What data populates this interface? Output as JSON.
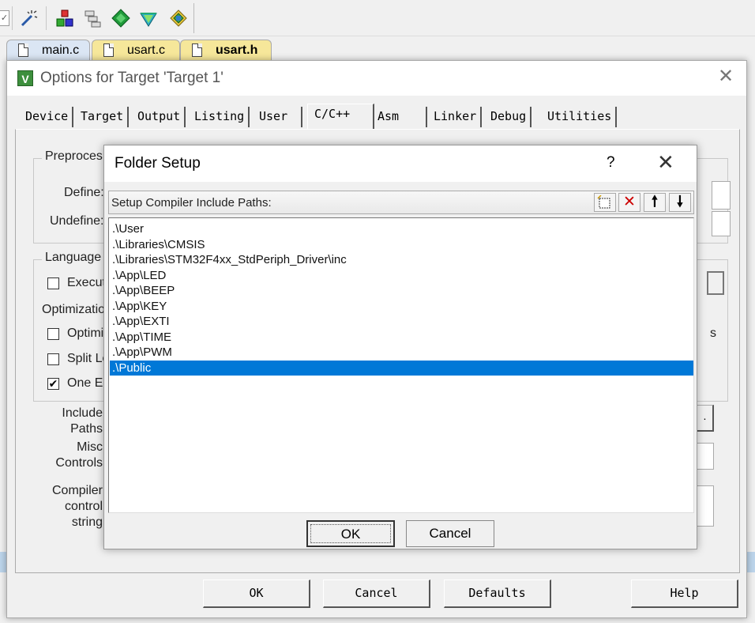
{
  "toolbar": {
    "icons": [
      "check-icon",
      "magic-wand-icon",
      "target-options-icon",
      "manage-components-icon",
      "pack-installer-icon",
      "select-software-icon",
      "run-time-environment-icon"
    ]
  },
  "file_tabs": [
    {
      "name": "main.c",
      "color": "#dbe6f4"
    },
    {
      "name": "usart.c",
      "color": "#f6e79a"
    },
    {
      "name": "usart.h",
      "color": "#f6e79a"
    }
  ],
  "options_dialog": {
    "title": "Options for Target 'Target 1'",
    "tabs": [
      "Device",
      "Target",
      "Output",
      "Listing",
      "User",
      "C/C++",
      "Asm",
      "Linker",
      "Debug",
      "Utilities"
    ],
    "active_tab": "C/C++",
    "preprocessor_label": "Preproces",
    "define_label": "Define:",
    "undefine_label": "Undefine:",
    "language_label": "Language",
    "execute_label": "Execut",
    "optimization_label": "Optimizatio",
    "optimize_label": "Optimiz",
    "split_label": "Split Lo",
    "one_elf_label": "One El",
    "include_label": "Include",
    "paths_label": "Paths",
    "misc_label": "Misc",
    "controls_label": "Controls",
    "compiler_label": "Compiler",
    "control_label": "control",
    "string_label": "string",
    "partial_s": "s",
    "partial_dots": ".",
    "buttons": {
      "ok": "OK",
      "cancel": "Cancel",
      "defaults": "Defaults",
      "help": "Help"
    }
  },
  "folder_setup": {
    "title": "Folder Setup",
    "help": "?",
    "caption": "Setup Compiler Include Paths:",
    "toolbar_icons": [
      "new-folder-icon",
      "delete-icon",
      "move-up-icon",
      "move-down-icon"
    ],
    "paths": [
      ".\\User",
      ".\\Libraries\\CMSIS",
      ".\\Libraries\\STM32F4xx_StdPeriph_Driver\\inc",
      ".\\App\\LED",
      ".\\App\\BEEP",
      ".\\App\\KEY",
      ".\\App\\EXTI",
      ".\\App\\TIME",
      ".\\App\\PWM",
      ".\\Public"
    ],
    "selected_index": 9,
    "selection_color": "#0078d7",
    "ok": "OK",
    "cancel": "Cancel"
  }
}
